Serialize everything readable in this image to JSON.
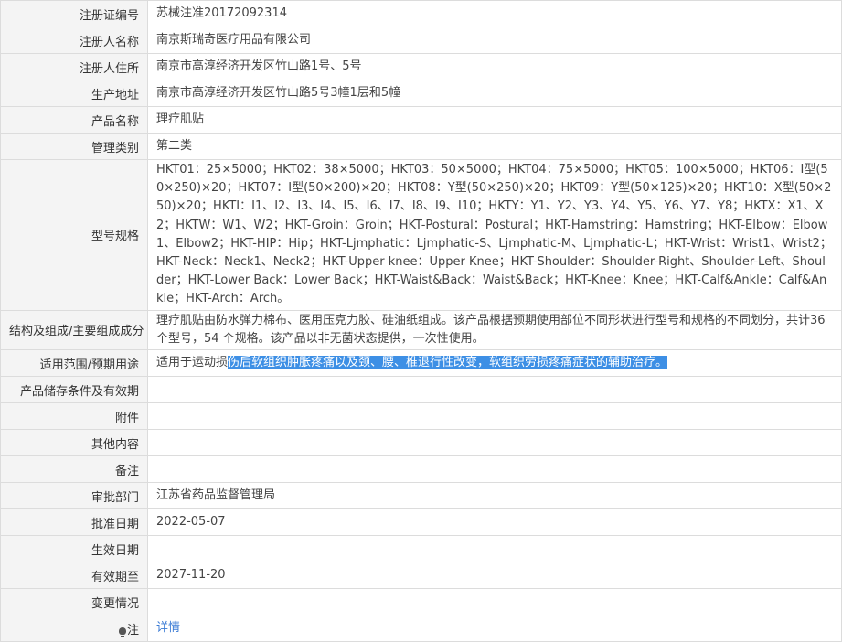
{
  "rows": [
    {
      "label": "注册证编号",
      "value": "苏械注准20172092314"
    },
    {
      "label": "注册人名称",
      "value": "南京斯瑞奇医疗用品有限公司"
    },
    {
      "label": "注册人住所",
      "value": "南京市高淳经济开发区竹山路1号、5号"
    },
    {
      "label": "生产地址",
      "value": "南京市高淳经济开发区竹山路5号3幢1层和5幢"
    },
    {
      "label": "产品名称",
      "value": "理疗肌贴"
    },
    {
      "label": "管理类别",
      "value": "第二类"
    },
    {
      "label": "型号规格",
      "value": "HKT01：25×5000；HKT02：38×5000；HKT03：50×5000；HKT04：75×5000；HKT05：100×5000；HKT06：I型(50×250)×20；HKT07：I型(50×200)×20；HKT08：Y型(50×250)×20；HKT09：Y型(50×125)×20；HKT10：X型(50×250)×20；HKTI：I1、I2、I3、I4、I5、I6、I7、I8、I9、I10；HKTY：Y1、Y2、Y3、Y4、Y5、Y6、Y7、Y8；HKTX：X1、X2；HKTW：W1、W2；HKT-Groin：Groin；HKT-Postural：Postural；HKT-Hamstring：Hamstring；HKT-Elbow：Elbow1、Elbow2；HKT-HIP：Hip；HKT-Ljmphatic：Ljmphatic-S、Ljmphatic-M、Ljmphatic-L；HKT-Wrist：Wrist1、Wrist2；HKT-Neck：Neck1、Neck2；HKT-Upper knee：Upper Knee；HKT-Shoulder：Shoulder-Right、Shoulder-Left、Shoulder；HKT-Lower Back：Lower Back；HKT-Waist&Back：Waist&Back；HKT-Knee：Knee；HKT-Calf&Ankle：Calf&Ankle；HKT-Arch：Arch。"
    },
    {
      "label": "结构及组成/主要组成成分",
      "value": "理疗肌贴由防水弹力棉布、医用压克力胶、硅油纸组成。该产品根据预期使用部位不同形状进行型号和规格的不同划分，共计36 个型号，54 个规格。该产品以非无菌状态提供，一次性使用。"
    },
    {
      "label": "适用范围/预期用途",
      "value_plain": "适用于运动损",
      "value_selected": "伤后软组织肿胀疼痛以及颈、腰、椎退行性改变，软组织劳损疼痛症状的辅助治疗。"
    },
    {
      "label": "产品储存条件及有效期",
      "value": ""
    },
    {
      "label": "附件",
      "value": ""
    },
    {
      "label": "其他内容",
      "value": ""
    },
    {
      "label": "备注",
      "value": ""
    },
    {
      "label": "审批部门",
      "value": "江苏省药品监督管理局"
    },
    {
      "label": "批准日期",
      "value": "2022-05-07"
    },
    {
      "label": "生效日期",
      "value": ""
    },
    {
      "label": "有效期至",
      "value": "2027-11-20"
    },
    {
      "label": "变更情况",
      "value": ""
    },
    {
      "label": "注",
      "value": "详情",
      "icon": "lightbulb-icon"
    }
  ],
  "colors": {
    "label_bg": "#f4f4f4",
    "border": "#dcdcdc",
    "selection": "#3d8fe5",
    "link": "#3a7bd5"
  }
}
